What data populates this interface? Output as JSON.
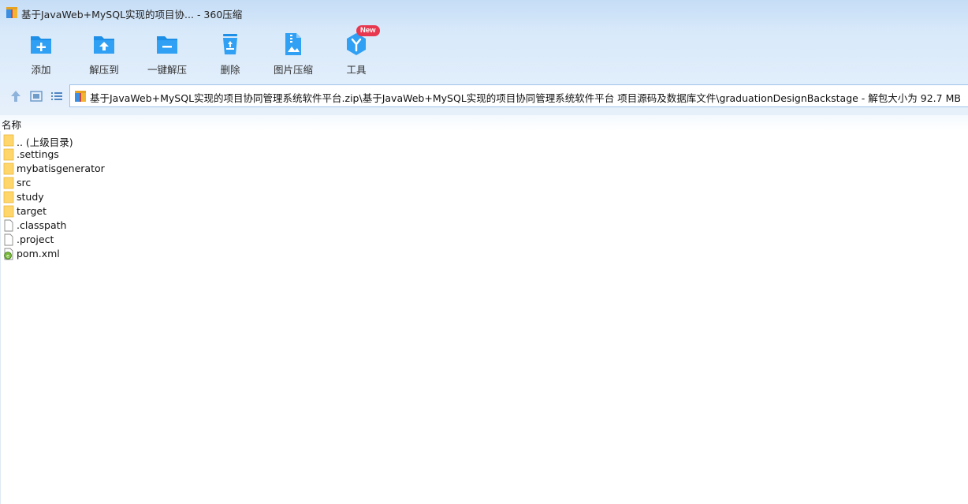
{
  "window": {
    "title": "基于JavaWeb+MySQL实现的项目协... - 360压缩",
    "app_icon": "archive-app-icon"
  },
  "toolbar": {
    "add": "添加",
    "extract_to": "解压到",
    "one_click_extract": "一键解压",
    "delete": "删除",
    "image_compress": "图片压缩",
    "tools": "工具",
    "tools_badge": "New"
  },
  "address": {
    "path": "基于JavaWeb+MySQL实现的项目协同管理系统软件平台.zip\\基于JavaWeb+MySQL实现的项目协同管理系统软件平台 项目源码及数据库文件\\graduationDesignBackstage - 解包大小为 92.7 MB"
  },
  "columns": {
    "name": "名称"
  },
  "files": [
    {
      "name": ".. (上级目录)",
      "type": "folder"
    },
    {
      "name": ".settings",
      "type": "folder"
    },
    {
      "name": "mybatisgenerator",
      "type": "folder"
    },
    {
      "name": "src",
      "type": "folder"
    },
    {
      "name": "study",
      "type": "folder"
    },
    {
      "name": "target",
      "type": "folder"
    },
    {
      "name": ".classpath",
      "type": "file"
    },
    {
      "name": ".project",
      "type": "file"
    },
    {
      "name": "pom.xml",
      "type": "xml"
    }
  ],
  "colors": {
    "accent": "#1e8fe6",
    "folder": "#ffd66b",
    "badge": "#e8384f"
  }
}
